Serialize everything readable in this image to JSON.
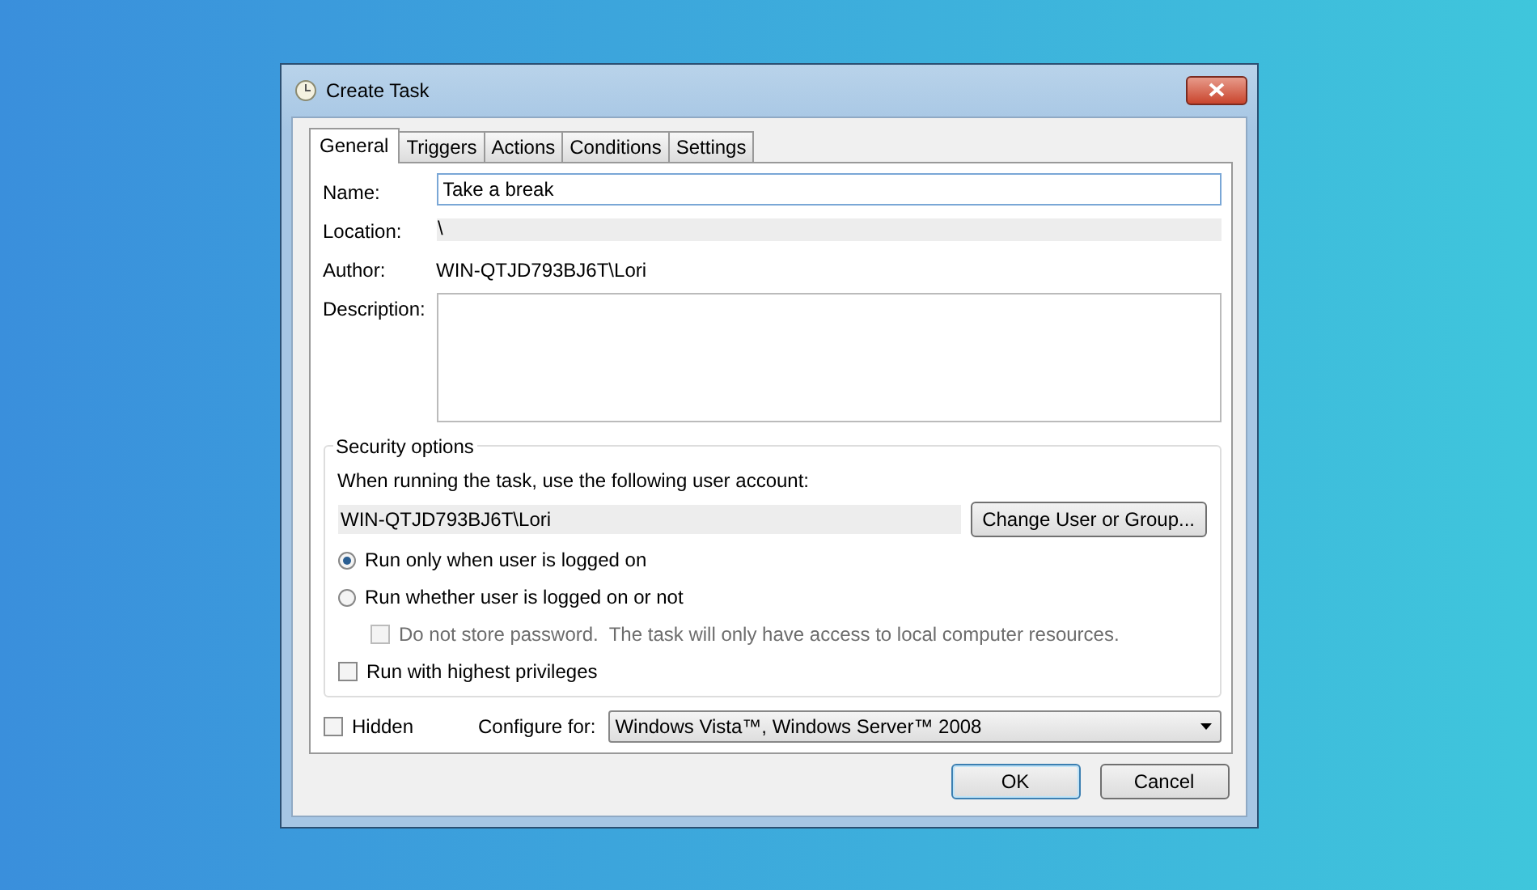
{
  "window": {
    "title": "Create Task"
  },
  "tabs": [
    {
      "label": "General",
      "selected": true
    },
    {
      "label": "Triggers",
      "selected": false
    },
    {
      "label": "Actions",
      "selected": false
    },
    {
      "label": "Conditions",
      "selected": false
    },
    {
      "label": "Settings",
      "selected": false
    }
  ],
  "fields": [
    {
      "label": "Name:",
      "kind": "input",
      "value": "Take a break"
    },
    {
      "label": "Location:",
      "kind": "readonly",
      "value": "\\"
    },
    {
      "label": "Author:",
      "kind": "text",
      "value": "WIN-QTJD793BJ6T\\Lori"
    },
    {
      "label": "Description:",
      "kind": "textarea"
    }
  ],
  "security": {
    "title": "Security options",
    "prompt": "When running the task, use the following user account:",
    "account": "WIN-QTJD793BJ6T\\Lori",
    "change_button": "Change User or Group...",
    "options": [
      {
        "kind": "radio",
        "label": "Run only when user is logged on",
        "selected": true
      },
      {
        "kind": "radio",
        "label": "Run whether user is logged on or not",
        "selected": false,
        "children": [
          {
            "kind": "checkbox",
            "label": "Do not store password.  The task will only have access to local computer resources.",
            "checked": false,
            "disabled": true
          }
        ]
      },
      {
        "kind": "checkbox",
        "label": "Run with highest privileges",
        "checked": false
      }
    ]
  },
  "hidden": {
    "label": "Hidden",
    "checked": false
  },
  "configure": {
    "label": "Configure for:",
    "value": "Windows Vista™, Windows Server™ 2008"
  },
  "buttons": [
    {
      "label": "OK",
      "default": true
    },
    {
      "label": "Cancel",
      "default": false
    }
  ]
}
